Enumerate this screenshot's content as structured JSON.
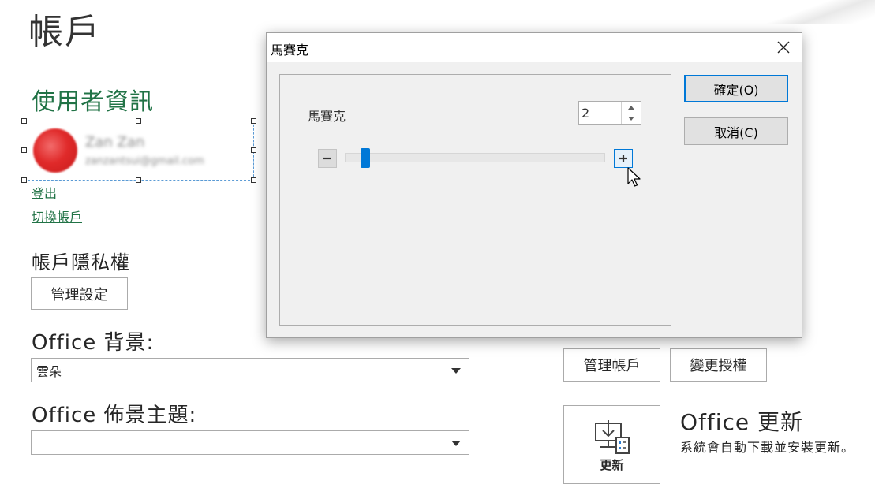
{
  "page": {
    "title": "帳戶"
  },
  "user_info": {
    "heading": "使用者資訊",
    "name": "Zan Zan",
    "email": "zanzantsui@gmail.com",
    "sign_out": "登出",
    "switch_account": "切換帳戶"
  },
  "privacy": {
    "heading": "帳戶隱私權",
    "manage_button": "管理設定"
  },
  "background": {
    "heading": "Office 背景:",
    "selected": "雲朵"
  },
  "theme": {
    "heading": "Office 佈景主題:",
    "selected": ""
  },
  "product": {
    "manage_account": "管理帳戶",
    "change_license": "變更授權"
  },
  "update": {
    "button_label": "更新",
    "title": "Office 更新",
    "description": "系統會自動下載並安裝更新。"
  },
  "dialog": {
    "title": "馬賽克",
    "label": "馬賽克",
    "value": "2",
    "ok_button": "確定(O)",
    "cancel_button": "取消(C)",
    "slider_fraction": 0.05
  },
  "colors": {
    "accent_green": "#217346",
    "accent_blue": "#0078d7"
  },
  "icons": [
    "close-icon",
    "spin-up-icon",
    "spin-down-icon",
    "minus-icon",
    "plus-icon",
    "mouse-cursor-icon",
    "update-download-icon"
  ]
}
